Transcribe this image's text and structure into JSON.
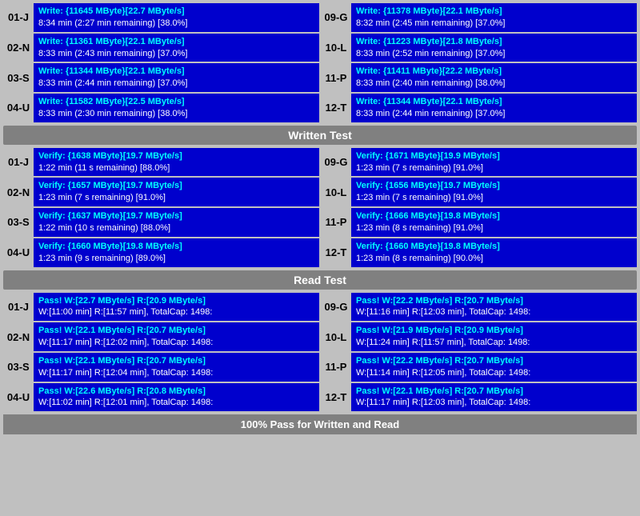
{
  "sections": {
    "write": {
      "rows_left": [
        {
          "id": "01-J",
          "line1": "Write: {11645 MByte}[22.7 MByte/s]",
          "line2": "8:34 min (2:27 min remaining)  [38.0%]"
        },
        {
          "id": "02-N",
          "line1": "Write: {11361 MByte}[22.1 MByte/s]",
          "line2": "8:33 min (2:43 min remaining)  [37.0%]"
        },
        {
          "id": "03-S",
          "line1": "Write: {11344 MByte}[22.1 MByte/s]",
          "line2": "8:33 min (2:44 min remaining)  [37.0%]"
        },
        {
          "id": "04-U",
          "line1": "Write: {11582 MByte}[22.5 MByte/s]",
          "line2": "8:33 min (2:30 min remaining)  [38.0%]"
        }
      ],
      "rows_right": [
        {
          "id": "09-G",
          "line1": "Write: {11378 MByte}[22.1 MByte/s]",
          "line2": "8:32 min (2:45 min remaining)  [37.0%]"
        },
        {
          "id": "10-L",
          "line1": "Write: {11223 MByte}[21.8 MByte/s]",
          "line2": "8:33 min (2:52 min remaining)  [37.0%]"
        },
        {
          "id": "11-P",
          "line1": "Write: {11411 MByte}[22.2 MByte/s]",
          "line2": "8:33 min (2:40 min remaining)  [38.0%]"
        },
        {
          "id": "12-T",
          "line1": "Write: {11344 MByte}[22.1 MByte/s]",
          "line2": "8:33 min (2:44 min remaining)  [37.0%]"
        }
      ],
      "header": "Written Test"
    },
    "verify": {
      "rows_left": [
        {
          "id": "01-J",
          "line1": "Verify: {1638 MByte}[19.7 MByte/s]",
          "line2": "1:22 min (11 s remaining)  [88.0%]"
        },
        {
          "id": "02-N",
          "line1": "Verify: {1657 MByte}[19.7 MByte/s]",
          "line2": "1:23 min (7 s remaining)  [91.0%]"
        },
        {
          "id": "03-S",
          "line1": "Verify: {1637 MByte}[19.7 MByte/s]",
          "line2": "1:22 min (10 s remaining)  [88.0%]"
        },
        {
          "id": "04-U",
          "line1": "Verify: {1660 MByte}[19.8 MByte/s]",
          "line2": "1:23 min (9 s remaining)  [89.0%]"
        }
      ],
      "rows_right": [
        {
          "id": "09-G",
          "line1": "Verify: {1671 MByte}[19.9 MByte/s]",
          "line2": "1:23 min (7 s remaining)  [91.0%]"
        },
        {
          "id": "10-L",
          "line1": "Verify: {1656 MByte}[19.7 MByte/s]",
          "line2": "1:23 min (7 s remaining)  [91.0%]"
        },
        {
          "id": "11-P",
          "line1": "Verify: {1666 MByte}[19.8 MByte/s]",
          "line2": "1:23 min (8 s remaining)  [91.0%]"
        },
        {
          "id": "12-T",
          "line1": "Verify: {1660 MByte}[19.8 MByte/s]",
          "line2": "1:23 min (8 s remaining)  [90.0%]"
        }
      ],
      "header": "Read Test"
    },
    "pass": {
      "rows_left": [
        {
          "id": "01-J",
          "line1": "Pass! W:[22.7 MByte/s] R:[20.9 MByte/s]",
          "line2": "W:[11:00 min] R:[11:57 min], TotalCap: 1498:"
        },
        {
          "id": "02-N",
          "line1": "Pass! W:[22.1 MByte/s] R:[20.7 MByte/s]",
          "line2": "W:[11:17 min] R:[12:02 min], TotalCap: 1498:"
        },
        {
          "id": "03-S",
          "line1": "Pass! W:[22.1 MByte/s] R:[20.7 MByte/s]",
          "line2": "W:[11:17 min] R:[12:04 min], TotalCap: 1498:"
        },
        {
          "id": "04-U",
          "line1": "Pass! W:[22.6 MByte/s] R:[20.8 MByte/s]",
          "line2": "W:[11:02 min] R:[12:01 min], TotalCap: 1498:"
        }
      ],
      "rows_right": [
        {
          "id": "09-G",
          "line1": "Pass! W:[22.2 MByte/s] R:[20.7 MByte/s]",
          "line2": "W:[11:16 min] R:[12:03 min], TotalCap: 1498:"
        },
        {
          "id": "10-L",
          "line1": "Pass! W:[21.9 MByte/s] R:[20.9 MByte/s]",
          "line2": "W:[11:24 min] R:[11:57 min], TotalCap: 1498:"
        },
        {
          "id": "11-P",
          "line1": "Pass! W:[22.2 MByte/s] R:[20.7 MByte/s]",
          "line2": "W:[11:14 min] R:[12:05 min], TotalCap: 1498:"
        },
        {
          "id": "12-T",
          "line1": "Pass! W:[22.1 MByte/s] R:[20.7 MByte/s]",
          "line2": "W:[11:17 min] R:[12:03 min], TotalCap: 1498:"
        }
      ]
    }
  },
  "footer": {
    "status": "100% Pass for Written and Read"
  },
  "headers": {
    "written_test": "Written Test",
    "read_test": "Read Test"
  }
}
